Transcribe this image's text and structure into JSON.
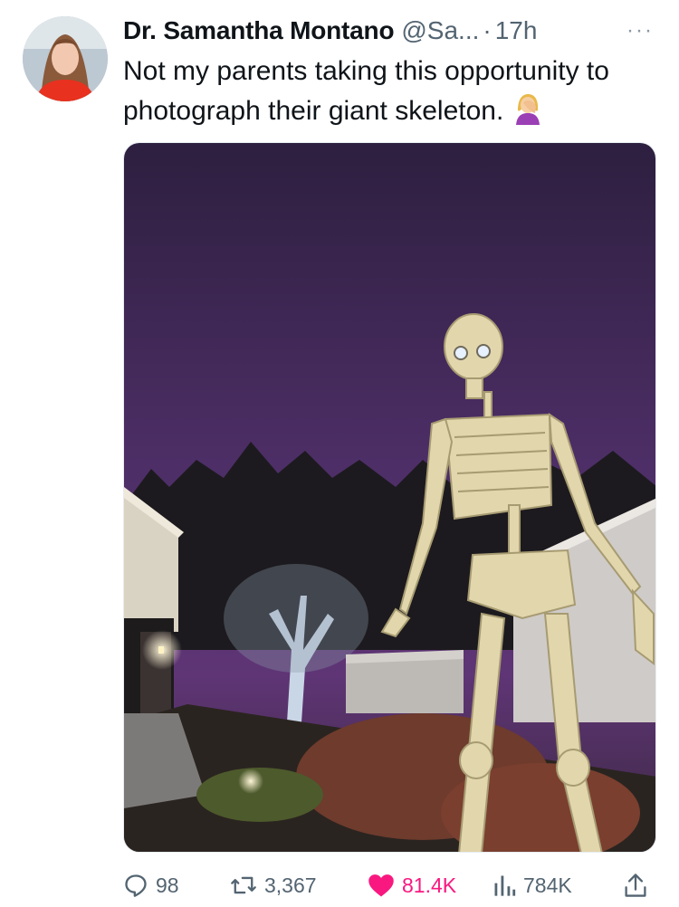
{
  "author": {
    "display_name": "Dr. Samantha Montano",
    "handle": "@Sa...",
    "separator": "·",
    "time": "17h",
    "more_label": "···"
  },
  "tweet": {
    "text": "Not my parents taking this opportunity to photograph their giant skeleton.",
    "emoji": "woman-facepalming"
  },
  "media": {
    "subject": "giant-skeleton-photo"
  },
  "actions": {
    "replies": "98",
    "retweets": "3,367",
    "likes": "81.4K",
    "views": "784K"
  },
  "colors": {
    "like_active": "#f91880",
    "muted": "#536471",
    "text": "#0f1419"
  }
}
